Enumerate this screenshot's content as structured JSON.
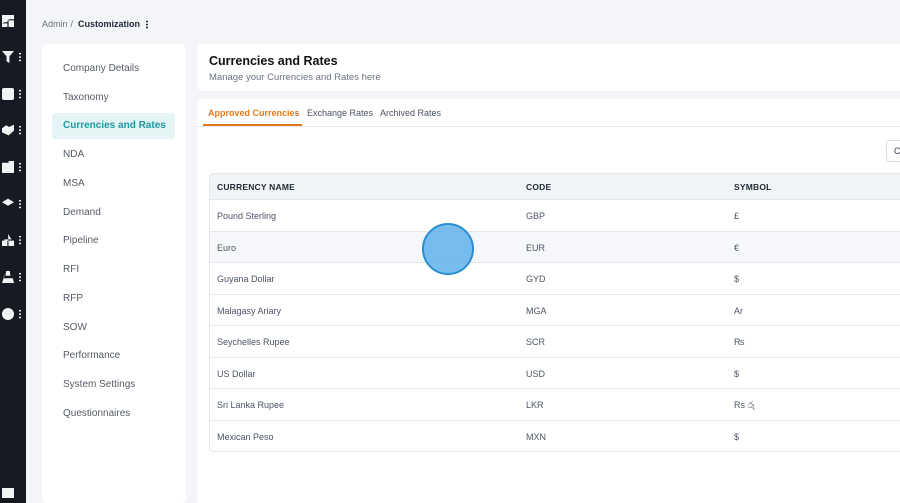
{
  "rail": {
    "items": [
      {
        "icon": "dashboard-icon"
      },
      {
        "icon": "filter-icon"
      },
      {
        "icon": "clipboard-icon"
      },
      {
        "icon": "handshake-icon"
      },
      {
        "icon": "building-icon"
      },
      {
        "icon": "graduation-cap-icon"
      },
      {
        "icon": "shapes-icon"
      },
      {
        "icon": "user-icon"
      },
      {
        "icon": "settings-shield-icon"
      }
    ],
    "bottom_icon": "book-icon"
  },
  "breadcrumb": {
    "root": "Admin",
    "separator": "/",
    "current": "Customization"
  },
  "menu": {
    "items": [
      {
        "label": "Company Details"
      },
      {
        "label": "Taxonomy"
      },
      {
        "label": "Currencies and Rates",
        "active": true
      },
      {
        "label": "NDA"
      },
      {
        "label": "MSA"
      },
      {
        "label": "Demand"
      },
      {
        "label": "Pipeline"
      },
      {
        "label": "RFI"
      },
      {
        "label": "RFP"
      },
      {
        "label": "SOW"
      },
      {
        "label": "Performance"
      },
      {
        "label": "System Settings"
      },
      {
        "label": "Questionnaires"
      }
    ]
  },
  "header": {
    "title": "Currencies and Rates",
    "subtitle": "Manage your Currencies and Rates here"
  },
  "tabs": [
    {
      "label": "Approved Currencies",
      "active": true
    },
    {
      "label": "Exchange Rates"
    },
    {
      "label": "Archived Rates"
    }
  ],
  "corner_button_label": "C",
  "table": {
    "headers": [
      "CURRENCY NAME",
      "CODE",
      "SYMBOL"
    ],
    "rows": [
      {
        "name": "Pound Sterling",
        "code": "GBP",
        "symbol": "£"
      },
      {
        "name": "Euro",
        "code": "EUR",
        "symbol": "€"
      },
      {
        "name": "Guyana Dollar",
        "code": "GYD",
        "symbol": "$"
      },
      {
        "name": "Malagasy Ariary",
        "code": "MGA",
        "symbol": "Ar"
      },
      {
        "name": "Seychelles Rupee",
        "code": "SCR",
        "symbol": "₨"
      },
      {
        "name": "US Dollar",
        "code": "USD",
        "symbol": "$"
      },
      {
        "name": "Sri Lanka Rupee",
        "code": "LKR",
        "symbol": "Rs රු"
      },
      {
        "name": "Mexican Peso",
        "code": "MXN",
        "symbol": "$"
      }
    ]
  },
  "colors": {
    "accent_tab": "#e07a1f",
    "active_menu": "#1c9aa0",
    "rail": "#161a22"
  }
}
